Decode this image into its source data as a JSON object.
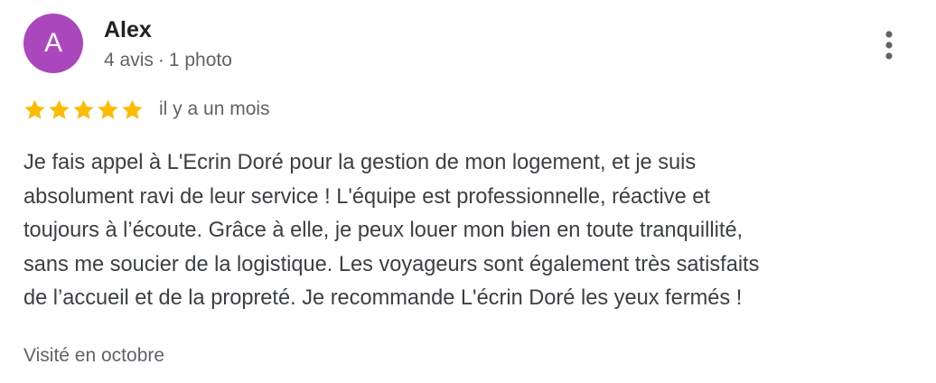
{
  "review": {
    "avatar_letter": "A",
    "avatar_color": "#ab47bc",
    "reviewer_name": "Alex",
    "review_count": "4 avis",
    "separator": "·",
    "photo_count": "1 photo",
    "more_icon": "more-vert-icon",
    "rating": 5,
    "rating_max": 5,
    "star_color": "#fbbc04",
    "date": "il y a un mois",
    "text_lines": [
      "Je fais appel à L'Ecrin Doré pour la gestion de mon logement, et je suis",
      "absolument ravi de leur service ! L'équipe est professionnelle, réactive et",
      "toujours à l’écoute. Grâce à elle, je peux louer mon bien en toute tranquillité,",
      "sans me soucier de la logistique. Les voyageurs sont également très satisfaits",
      "de l’accueil et de la propreté. Je recommande L'écrin Doré les yeux fermés !"
    ],
    "visited": "Visité en octobre"
  }
}
